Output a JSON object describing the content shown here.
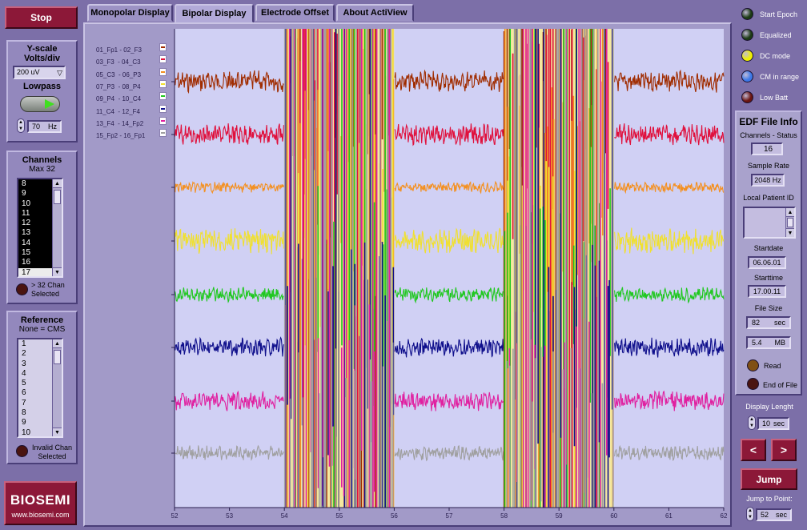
{
  "stop_label": "Stop",
  "yscale": {
    "title": "Y-scale Volts/div",
    "value": "200 uV",
    "lowpass_label": "Lowpass",
    "lowpass_value": "70",
    "lowpass_unit": "Hz"
  },
  "channels": {
    "title": "Channels",
    "subtitle": "Max 32",
    "items": [
      "8",
      "9",
      "10",
      "11",
      "12",
      "13",
      "14",
      "15",
      "16",
      "17"
    ],
    "selected_index": 9,
    "indicator_label": "> 32 Chan Selected"
  },
  "reference": {
    "title": "Reference",
    "subtitle": "None = CMS",
    "items": [
      "1",
      "2",
      "3",
      "4",
      "5",
      "6",
      "7",
      "8",
      "9",
      "10"
    ],
    "indicator_label": "Invalid Chan Selected"
  },
  "logo": {
    "text": "BIOSEMI",
    "url": "www.biosemi.com"
  },
  "tabs": [
    {
      "label": "Monopolar Display",
      "active": false
    },
    {
      "label": "Bipolar Display",
      "active": true
    },
    {
      "label": "Electrode Offset",
      "active": false
    },
    {
      "label": "About ActiView",
      "active": false
    }
  ],
  "legend": [
    {
      "label": "01_Fp1 - 02_F3",
      "color": "#a02c00"
    },
    {
      "label": "03_F3  - 04_C3",
      "color": "#e0103c"
    },
    {
      "label": "05_C3  - 06_P3",
      "color": "#f49020"
    },
    {
      "label": "07_P3  - 08_P4",
      "color": "#f0e030"
    },
    {
      "label": "09_P4  - 10_C4",
      "color": "#20c820"
    },
    {
      "label": "11_C4  - 12_F4",
      "color": "#10108c"
    },
    {
      "label": "13_F4  - 14_Fp2",
      "color": "#e020a0"
    },
    {
      "label": "15_Fp2 - 16_Fp1",
      "color": "#a0a0a0"
    }
  ],
  "chart_data": {
    "type": "line",
    "xlim": [
      52,
      62
    ],
    "x_ticks": [
      "52",
      "53",
      "54",
      "55",
      "56",
      "57",
      "58",
      "59",
      "60",
      "61",
      "62"
    ],
    "artifact_intervals": [
      [
        54,
        56
      ],
      [
        58,
        60
      ]
    ],
    "series": [
      {
        "name": "01_Fp1 - 02_F3",
        "color": "#a02c00"
      },
      {
        "name": "03_F3  - 04_C3",
        "color": "#e0103c"
      },
      {
        "name": "05_C3  - 06_P3",
        "color": "#f49020"
      },
      {
        "name": "07_P3  - 08_P4",
        "color": "#f0e030"
      },
      {
        "name": "09_P4  - 10_C4",
        "color": "#20c820"
      },
      {
        "name": "11_C4  - 12_F4",
        "color": "#10108c"
      },
      {
        "name": "13_F4  - 14_Fp2",
        "color": "#e020a0"
      },
      {
        "name": "15_Fp2 - 16_Fp1",
        "color": "#a0a0a0"
      }
    ],
    "grid": false,
    "background": "#d0d0f4"
  },
  "status_leds": [
    {
      "label": "Start Epoch",
      "color": "#1c3a14"
    },
    {
      "label": "Equalized",
      "color": "#1c3a14"
    },
    {
      "label": "DC mode",
      "color": "#f0f000"
    },
    {
      "label": "CM in range",
      "color": "#3c78e8"
    },
    {
      "label": "Low Batt",
      "color": "#6a1410"
    }
  ],
  "edf": {
    "title": "EDF File Info",
    "channels_label": "Channels - Status",
    "channels_value": "16",
    "sample_rate_label": "Sample Rate",
    "sample_rate_value": "2048 Hz",
    "patient_label": "Local Patient ID",
    "startdate_label": "Startdate",
    "startdate_value": "06.06.01",
    "starttime_label": "Starttime",
    "starttime_value": "17.00.11",
    "filesize_label": "File Size",
    "filesize_sec": "82",
    "filesize_sec_unit": "sec",
    "filesize_mb": "5.4",
    "filesize_mb_unit": "MB",
    "read_label": "Read",
    "eof_label": "End of File"
  },
  "display_length": {
    "label": "Display Lenght",
    "value": "10",
    "unit": "sec"
  },
  "nav": {
    "prev": "<",
    "next": ">"
  },
  "jump": {
    "label": "Jump",
    "point_label": "Jump to Point:",
    "point_value": "52",
    "point_unit": "sec"
  }
}
